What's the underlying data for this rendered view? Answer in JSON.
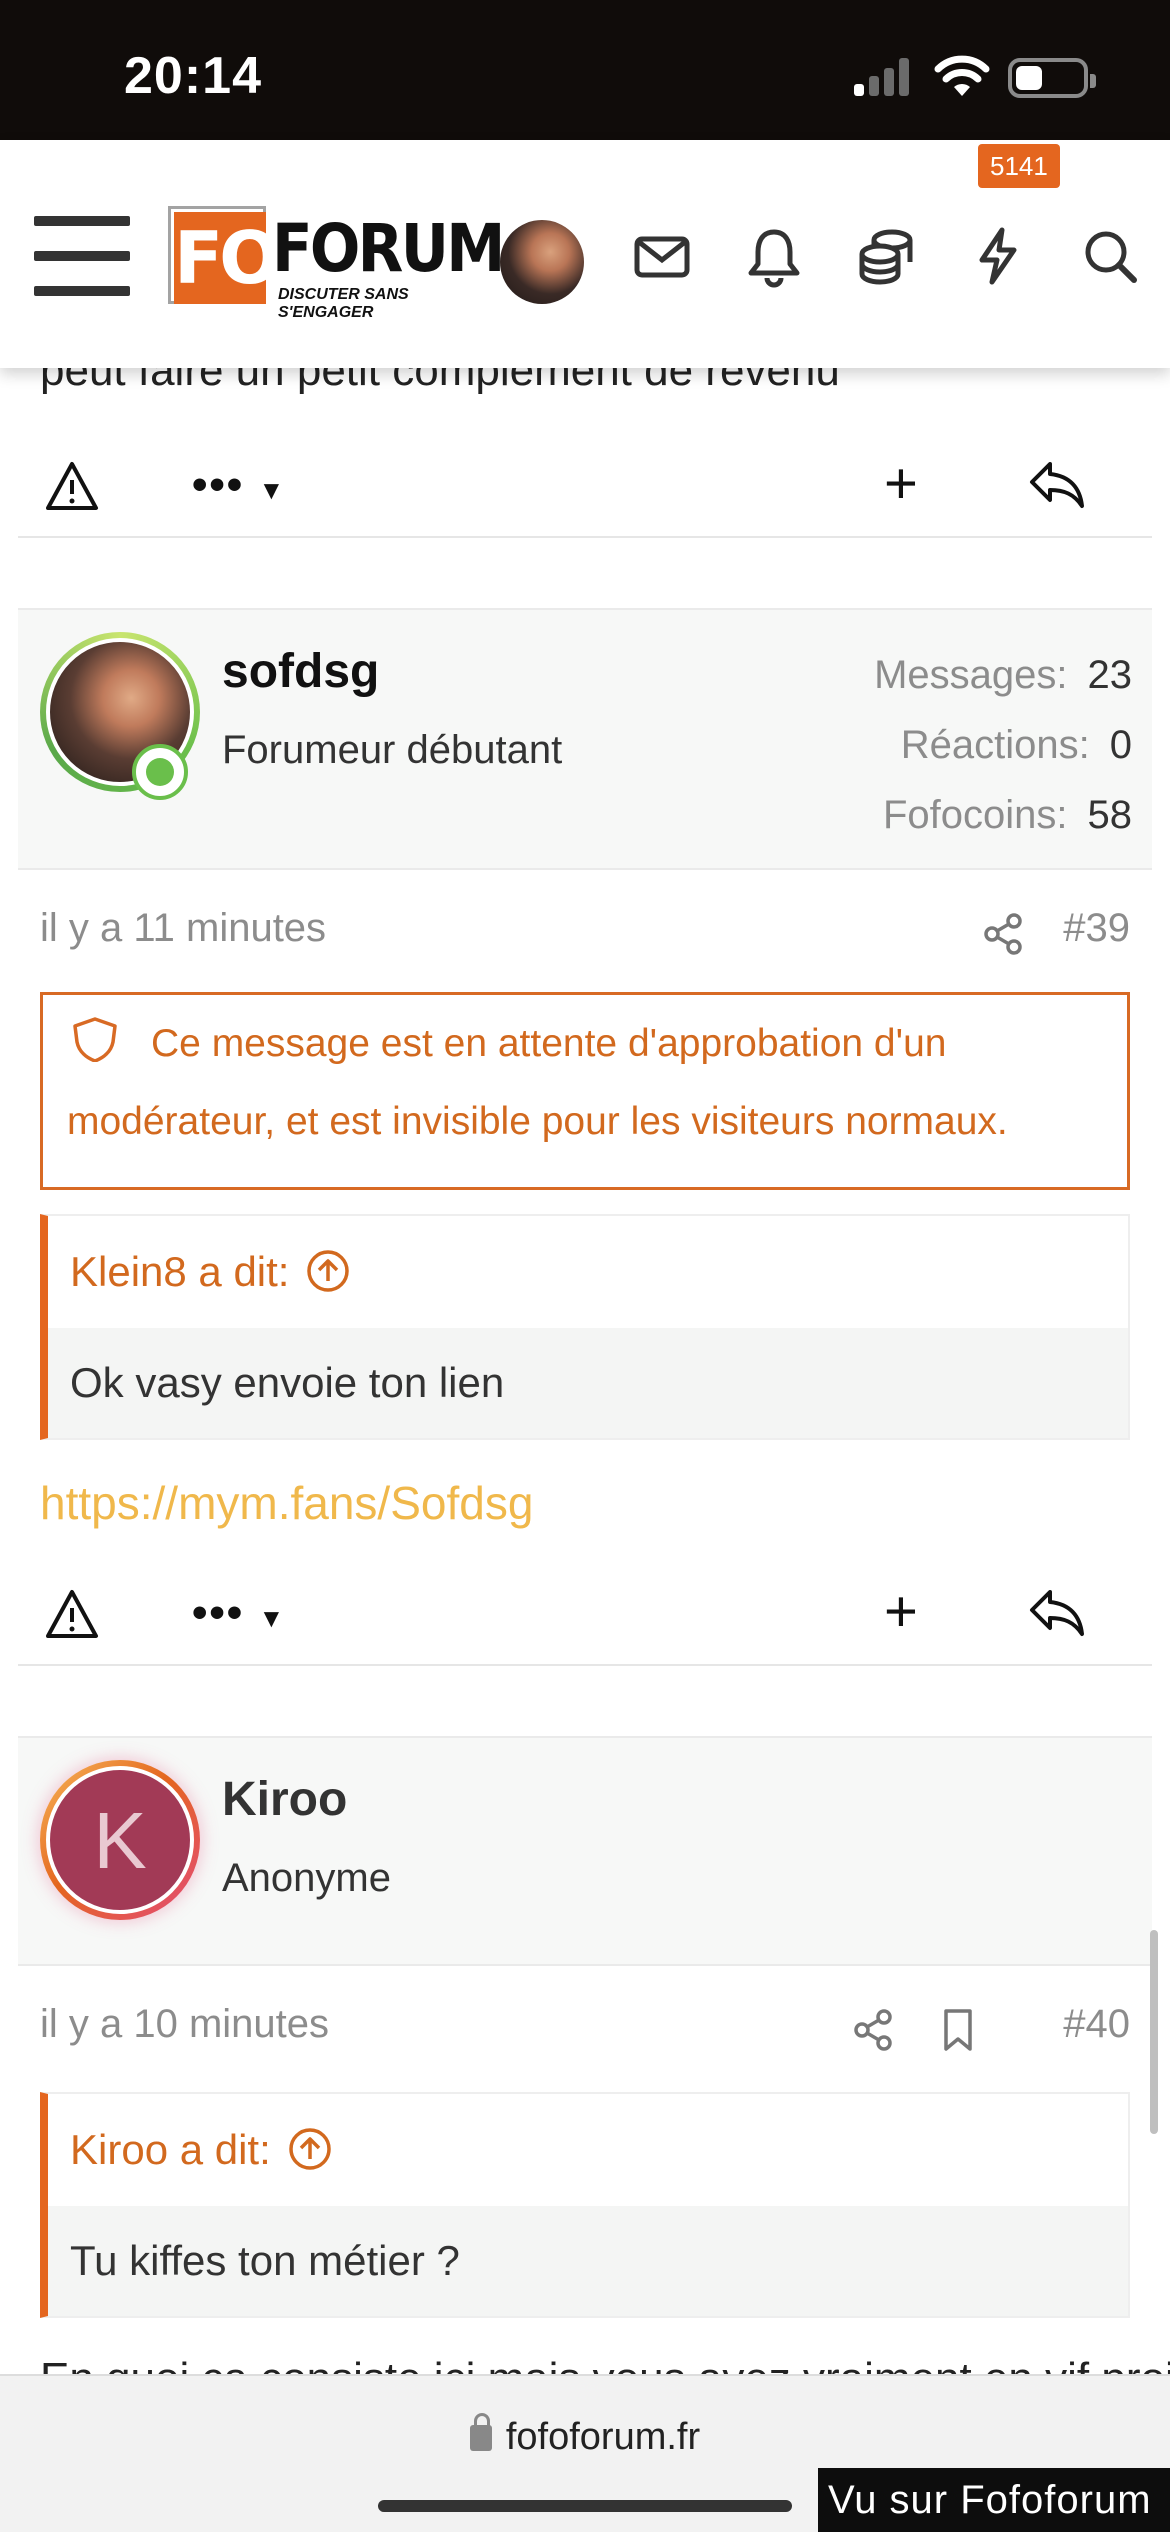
{
  "status_bar": {
    "time": "20:14"
  },
  "header": {
    "logo_fo": "FO",
    "logo_forum": "FORUM",
    "logo_tagline": "DISCUTER SANS S'ENGAGER",
    "badge_count": "5141"
  },
  "partial_text_top": "peut faire un petit complément de revenu",
  "posts": [
    {
      "username": "sofdsg",
      "role": "Forumeur débutant",
      "stats": [
        {
          "label": "Messages:",
          "value": "23"
        },
        {
          "label": "Réactions:",
          "value": "0"
        },
        {
          "label": "Fofocoins:",
          "value": "58"
        }
      ],
      "time": "il y a 11 minutes",
      "number": "#39",
      "moderation_notice": "Ce message est en attente d'approbation d'un modérateur, et est invisible pour les visiteurs normaux.",
      "quote_author": "Klein8 a dit:",
      "quote_text": "Ok vasy envoie ton lien",
      "body_link": "https://mym.fans/Sofdsg",
      "online": true
    },
    {
      "username": "Kiroo",
      "avatar_letter": "K",
      "role": "Anonyme",
      "time": "il y a 10 minutes",
      "number": "#40",
      "quote_author": "Kiroo a dit:",
      "quote_text": "Tu kiffes ton métier ?",
      "partial_body": "En quoi ça consiste ici mais vous avez vraiment en vif projet"
    }
  ],
  "actions": {
    "more_label": "•••"
  },
  "browser": {
    "url": "fofoforum.fr"
  },
  "watermark": "Vu sur Fofoforum",
  "colors": {
    "accent": "#e4661f",
    "link": "#f0b84b",
    "moderation": "#d86a24"
  }
}
